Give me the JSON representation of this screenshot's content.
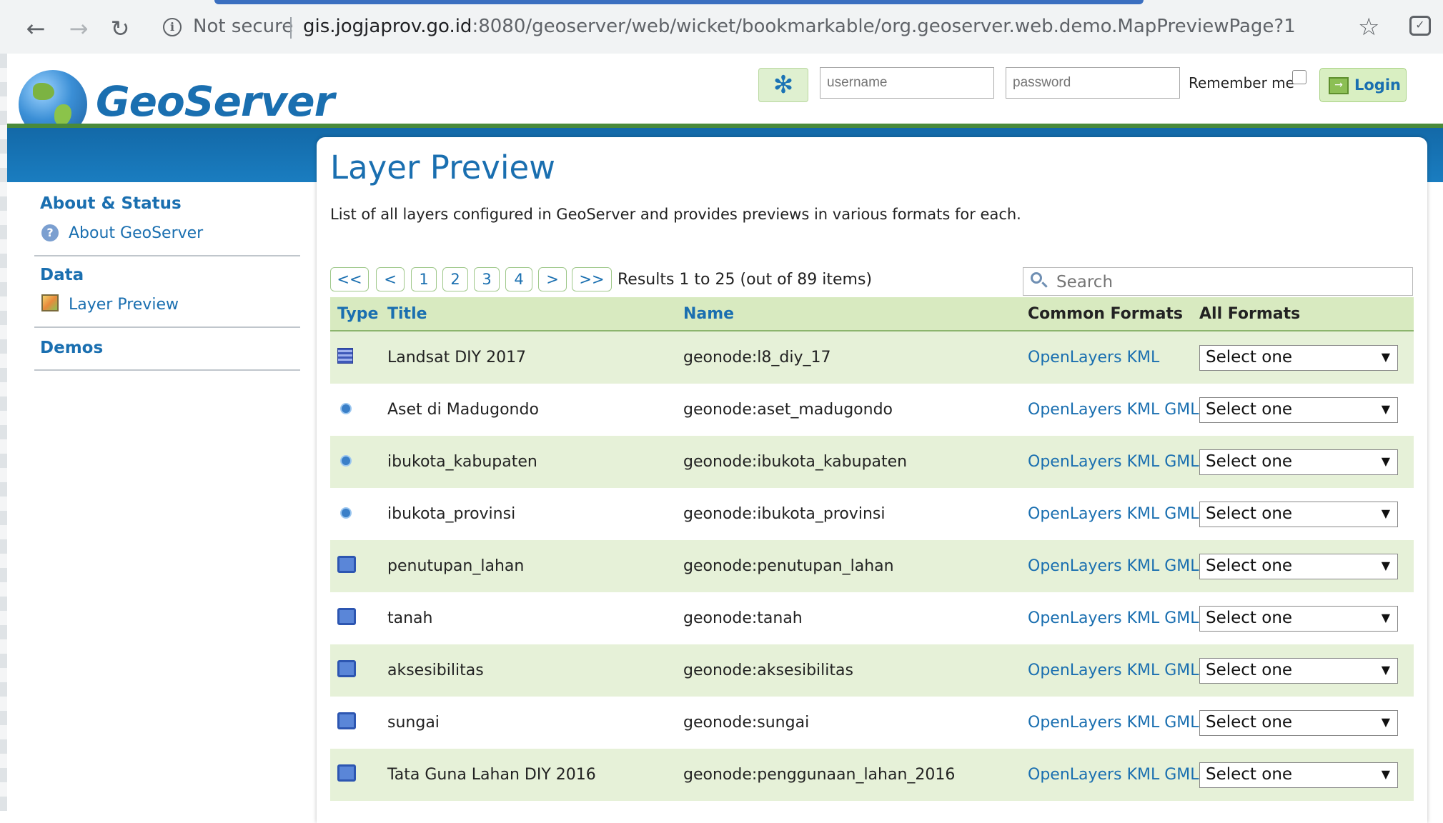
{
  "browser": {
    "security_label": "Not secure",
    "url_host": "gis.jogjaprov.go.id",
    "url_rest": ":8080/geoserver/web/wicket/bookmarkable/org.geoserver.web.demo.MapPreviewPage?1"
  },
  "header": {
    "logo_text": "GeoServer",
    "username_placeholder": "username",
    "password_placeholder": "password",
    "remember_label": "Remember me",
    "login_label": "Login"
  },
  "sidebar": {
    "sections": [
      {
        "title": "About & Status",
        "items": [
          {
            "label": "About GeoServer"
          }
        ]
      },
      {
        "title": "Data",
        "items": [
          {
            "label": "Layer Preview"
          }
        ]
      },
      {
        "title": "Demos",
        "items": []
      }
    ]
  },
  "main": {
    "title": "Layer Preview",
    "description": "List of all layers configured in GeoServer and provides previews in various formats for each.",
    "pager": {
      "first": "<<",
      "prev": "<",
      "pages": [
        "1",
        "2",
        "3",
        "4"
      ],
      "next": ">",
      "last": ">>",
      "results": "Results 1 to 25 (out of 89 items)"
    },
    "search_placeholder": "Search",
    "columns": [
      "Type",
      "Title",
      "Name",
      "Common Formats",
      "All Formats"
    ],
    "rows": [
      {
        "type": "raster",
        "title": "Landsat DIY 2017",
        "name": "geonode:l8_diy_17",
        "formats": [
          "OpenLayers",
          "KML"
        ],
        "select": "Select one"
      },
      {
        "type": "point",
        "title": "Aset di Madugondo",
        "name": "geonode:aset_madugondo",
        "formats": [
          "OpenLayers",
          "KML",
          "GML"
        ],
        "select": "Select one"
      },
      {
        "type": "point",
        "title": "ibukota_kabupaten",
        "name": "geonode:ibukota_kabupaten",
        "formats": [
          "OpenLayers",
          "KML",
          "GML"
        ],
        "select": "Select one"
      },
      {
        "type": "point",
        "title": "ibukota_provinsi",
        "name": "geonode:ibukota_provinsi",
        "formats": [
          "OpenLayers",
          "KML",
          "GML"
        ],
        "select": "Select one"
      },
      {
        "type": "polygon",
        "title": "penutupan_lahan",
        "name": "geonode:penutupan_lahan",
        "formats": [
          "OpenLayers",
          "KML",
          "GML"
        ],
        "select": "Select one"
      },
      {
        "type": "polygon",
        "title": "tanah",
        "name": "geonode:tanah",
        "formats": [
          "OpenLayers",
          "KML",
          "GML"
        ],
        "select": "Select one"
      },
      {
        "type": "polygon",
        "title": "aksesibilitas",
        "name": "geonode:aksesibilitas",
        "formats": [
          "OpenLayers",
          "KML",
          "GML"
        ],
        "select": "Select one"
      },
      {
        "type": "polygon",
        "title": "sungai",
        "name": "geonode:sungai",
        "formats": [
          "OpenLayers",
          "KML",
          "GML"
        ],
        "select": "Select one"
      },
      {
        "type": "polygon",
        "title": "Tata Guna Lahan DIY 2016",
        "name": "geonode:penggunaan_lahan_2016",
        "formats": [
          "OpenLayers",
          "KML",
          "GML"
        ],
        "select": "Select one"
      }
    ]
  }
}
